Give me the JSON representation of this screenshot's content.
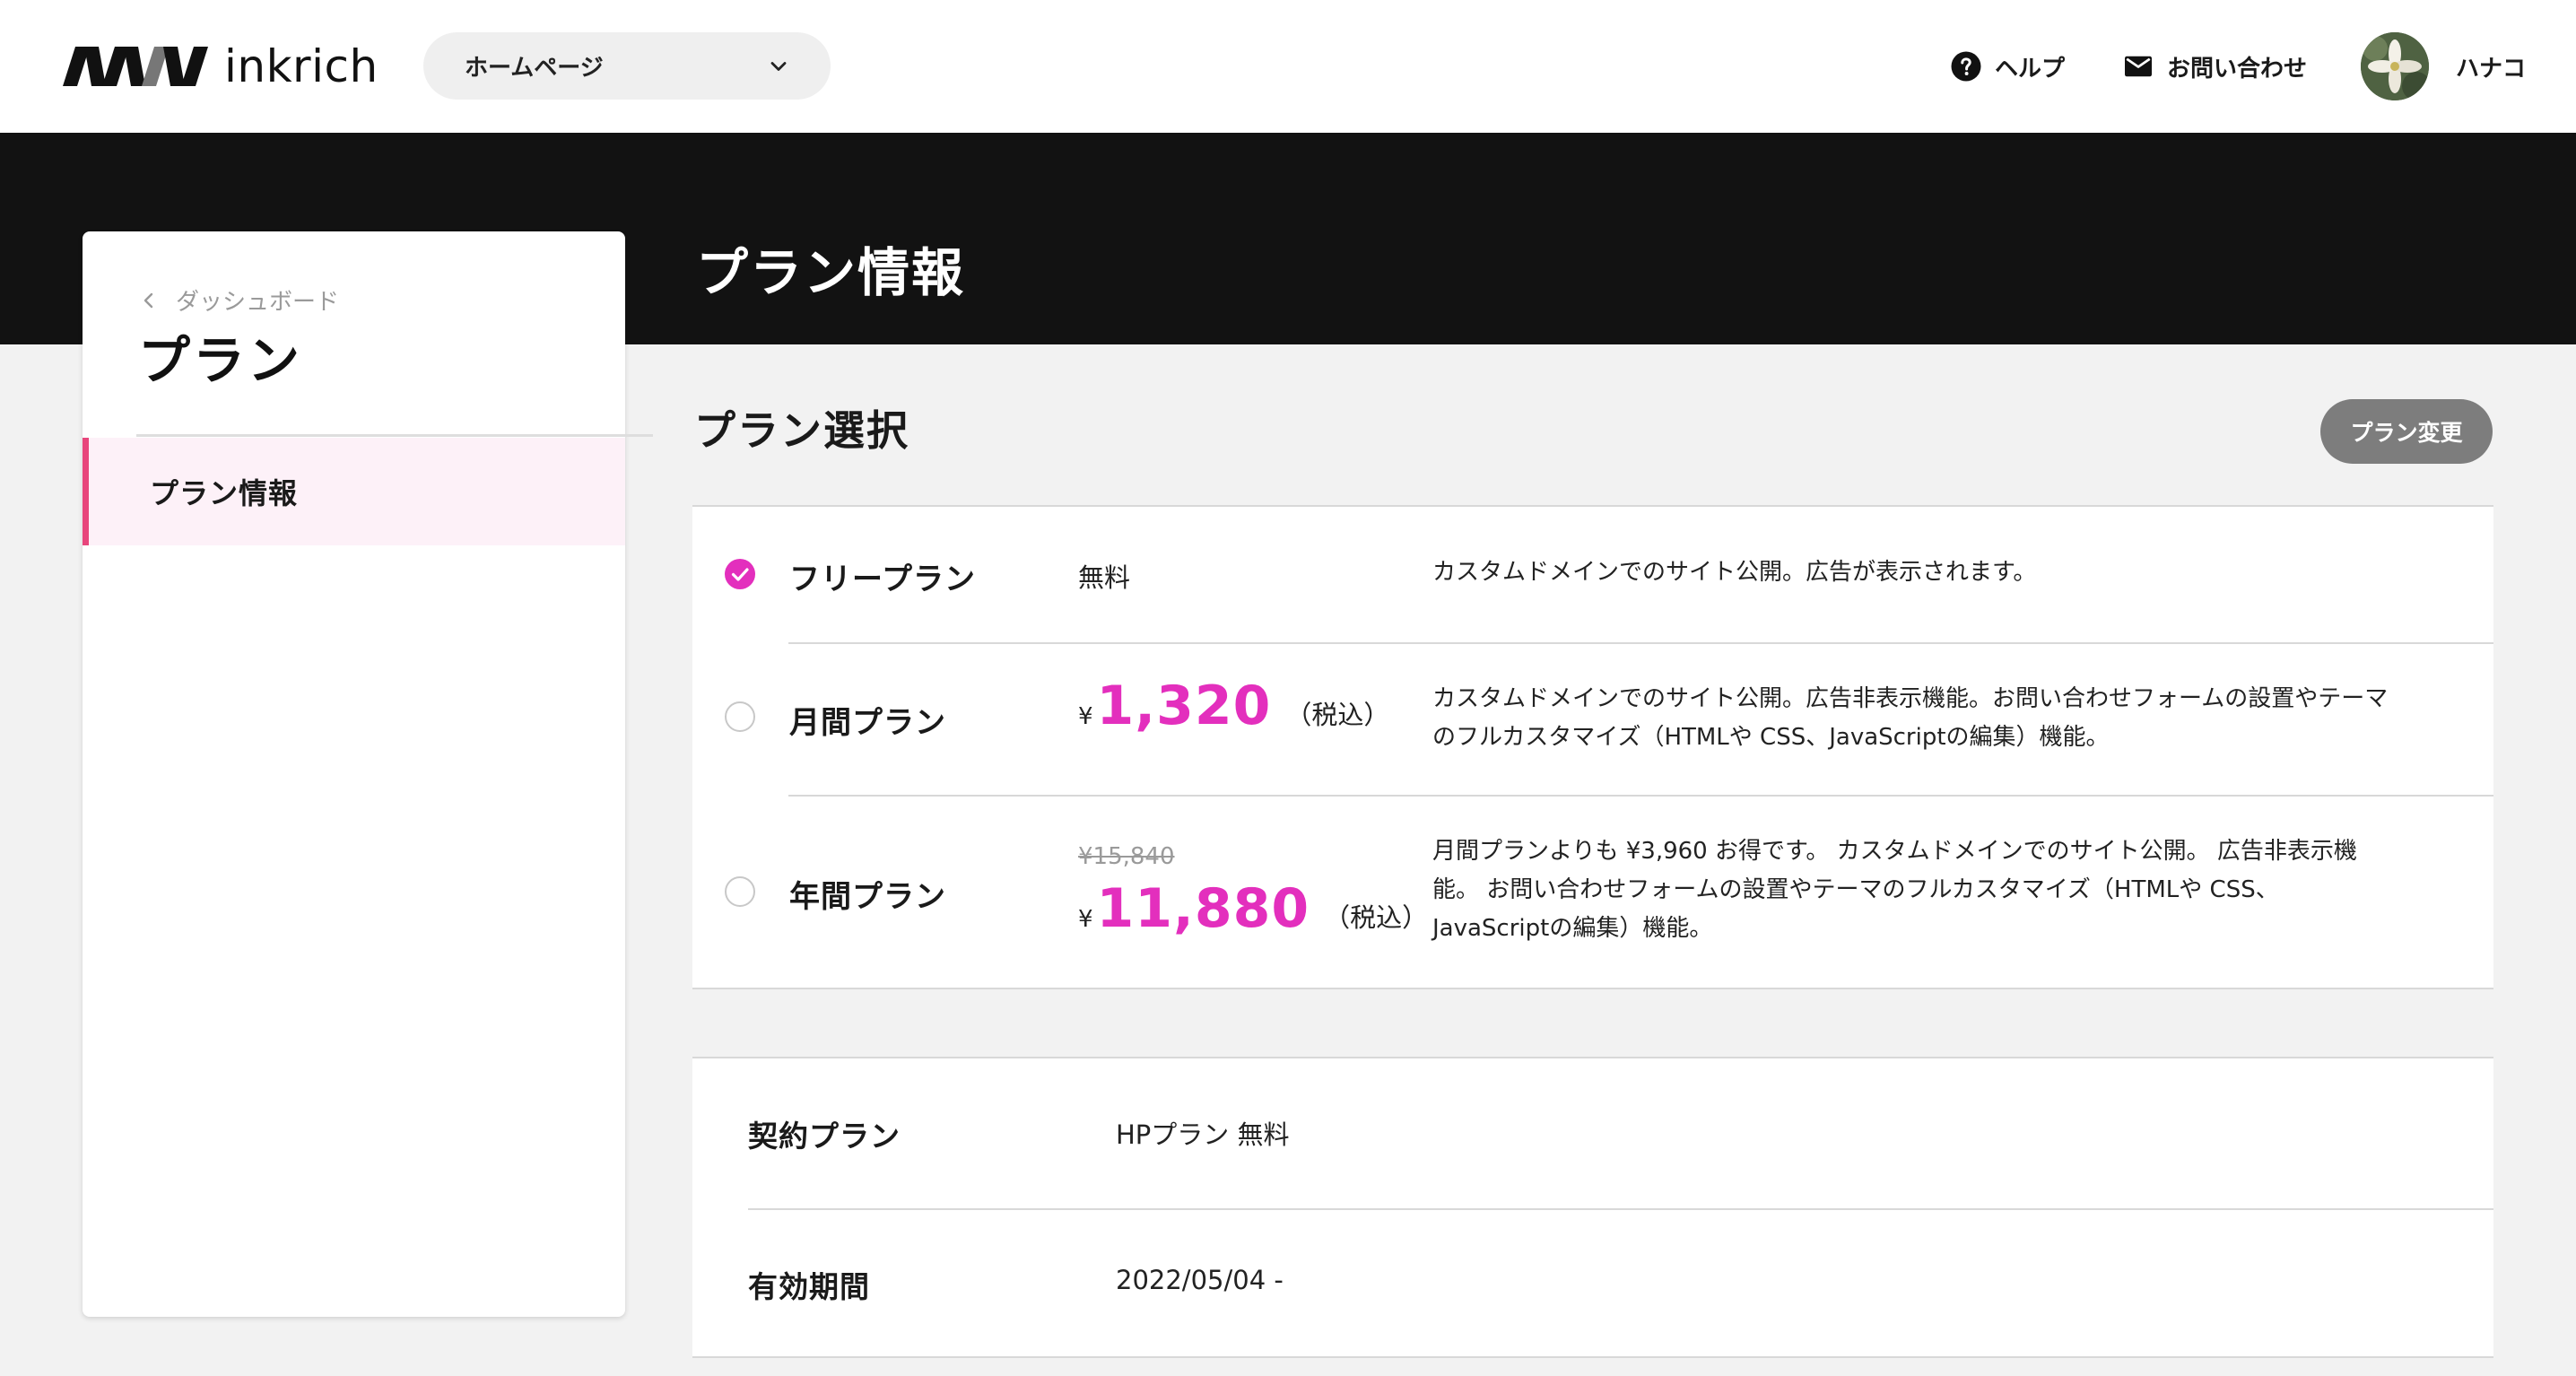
{
  "header": {
    "logo_text": "inkrich",
    "site_select": {
      "value": "ホームページ"
    },
    "help_label": "ヘルプ",
    "contact_label": "お問い合わせ",
    "user_name": "ハナコ",
    "icons": {
      "help": "help-circle-icon",
      "contact": "mail-icon",
      "site_select": "chevron-down-icon"
    }
  },
  "hero": {
    "title": "プラン情報"
  },
  "sidebar": {
    "back_label": "ダッシュボード",
    "title": "プラン",
    "items": [
      {
        "label": "プラン情報",
        "active": true
      }
    ]
  },
  "plans": {
    "title": "プラン選択",
    "change_button": "プラン変更",
    "rows": [
      {
        "name": "フリープラン",
        "price_text": "無料",
        "selected": true,
        "description": "カスタムドメインでのサイト公開。広告が表示されます。"
      },
      {
        "name": "月間プラン",
        "currency": "¥",
        "price": "1,320",
        "tax_note": "（税込）",
        "selected": false,
        "description_lines": [
          "カスタムドメインでのサイト公開。広告非表示機能。お問い合わせフォームの設置やテーマ",
          "のフルカスタマイズ（HTMLや CSS、JavaScriptの編集）機能。"
        ]
      },
      {
        "name": "年間プラン",
        "original_price": "¥15,840",
        "currency": "¥",
        "price": "11,880",
        "tax_note": "（税込）",
        "selected": false,
        "description_lines": [
          "月間プランよりも ¥3,960 お得です。 カスタムドメインでのサイト公開。 広告非表示機",
          "能。 お問い合わせフォームの設置やテーマのフルカスタマイズ（HTMLや CSS、",
          "JavaScriptの編集）機能。"
        ]
      }
    ]
  },
  "contract": {
    "rows": [
      {
        "label": "契約プラン",
        "value": "HPプラン 無料"
      },
      {
        "label": "有効期間",
        "value": "2022/05/04 -"
      }
    ]
  },
  "colors": {
    "accent": "#e32fbd",
    "sidebar_active_bg": "#fdf1f8",
    "sidebar_active_bar": "#e8467c",
    "hero_bg": "#121212",
    "button_bg": "#7d7d7d"
  }
}
